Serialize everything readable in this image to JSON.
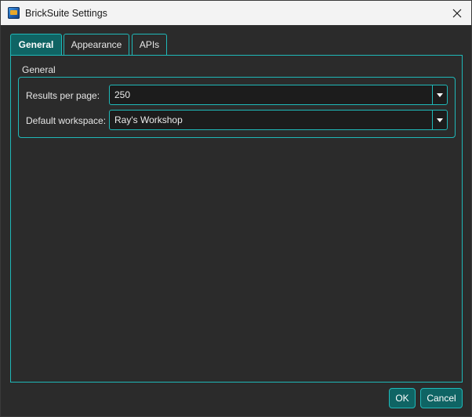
{
  "window": {
    "title": "BrickSuite Settings",
    "icons": {
      "app": "bricksuite-app-icon",
      "close": "close-icon"
    }
  },
  "tabs": [
    {
      "label": "General",
      "active": true
    },
    {
      "label": "Appearance",
      "active": false
    },
    {
      "label": "APIs",
      "active": false
    }
  ],
  "general": {
    "group_title": "General",
    "results_per_page": {
      "label": "Results per page:",
      "value": "250"
    },
    "default_workspace": {
      "label": "Default workspace:",
      "value": "Ray's Workshop"
    }
  },
  "buttons": {
    "ok": "OK",
    "cancel": "Cancel"
  },
  "colors": {
    "accent_border": "#1fb8b8",
    "accent_fill": "#0f6464",
    "background": "#2b2b2b",
    "titlebar": "#f3f3f3"
  }
}
